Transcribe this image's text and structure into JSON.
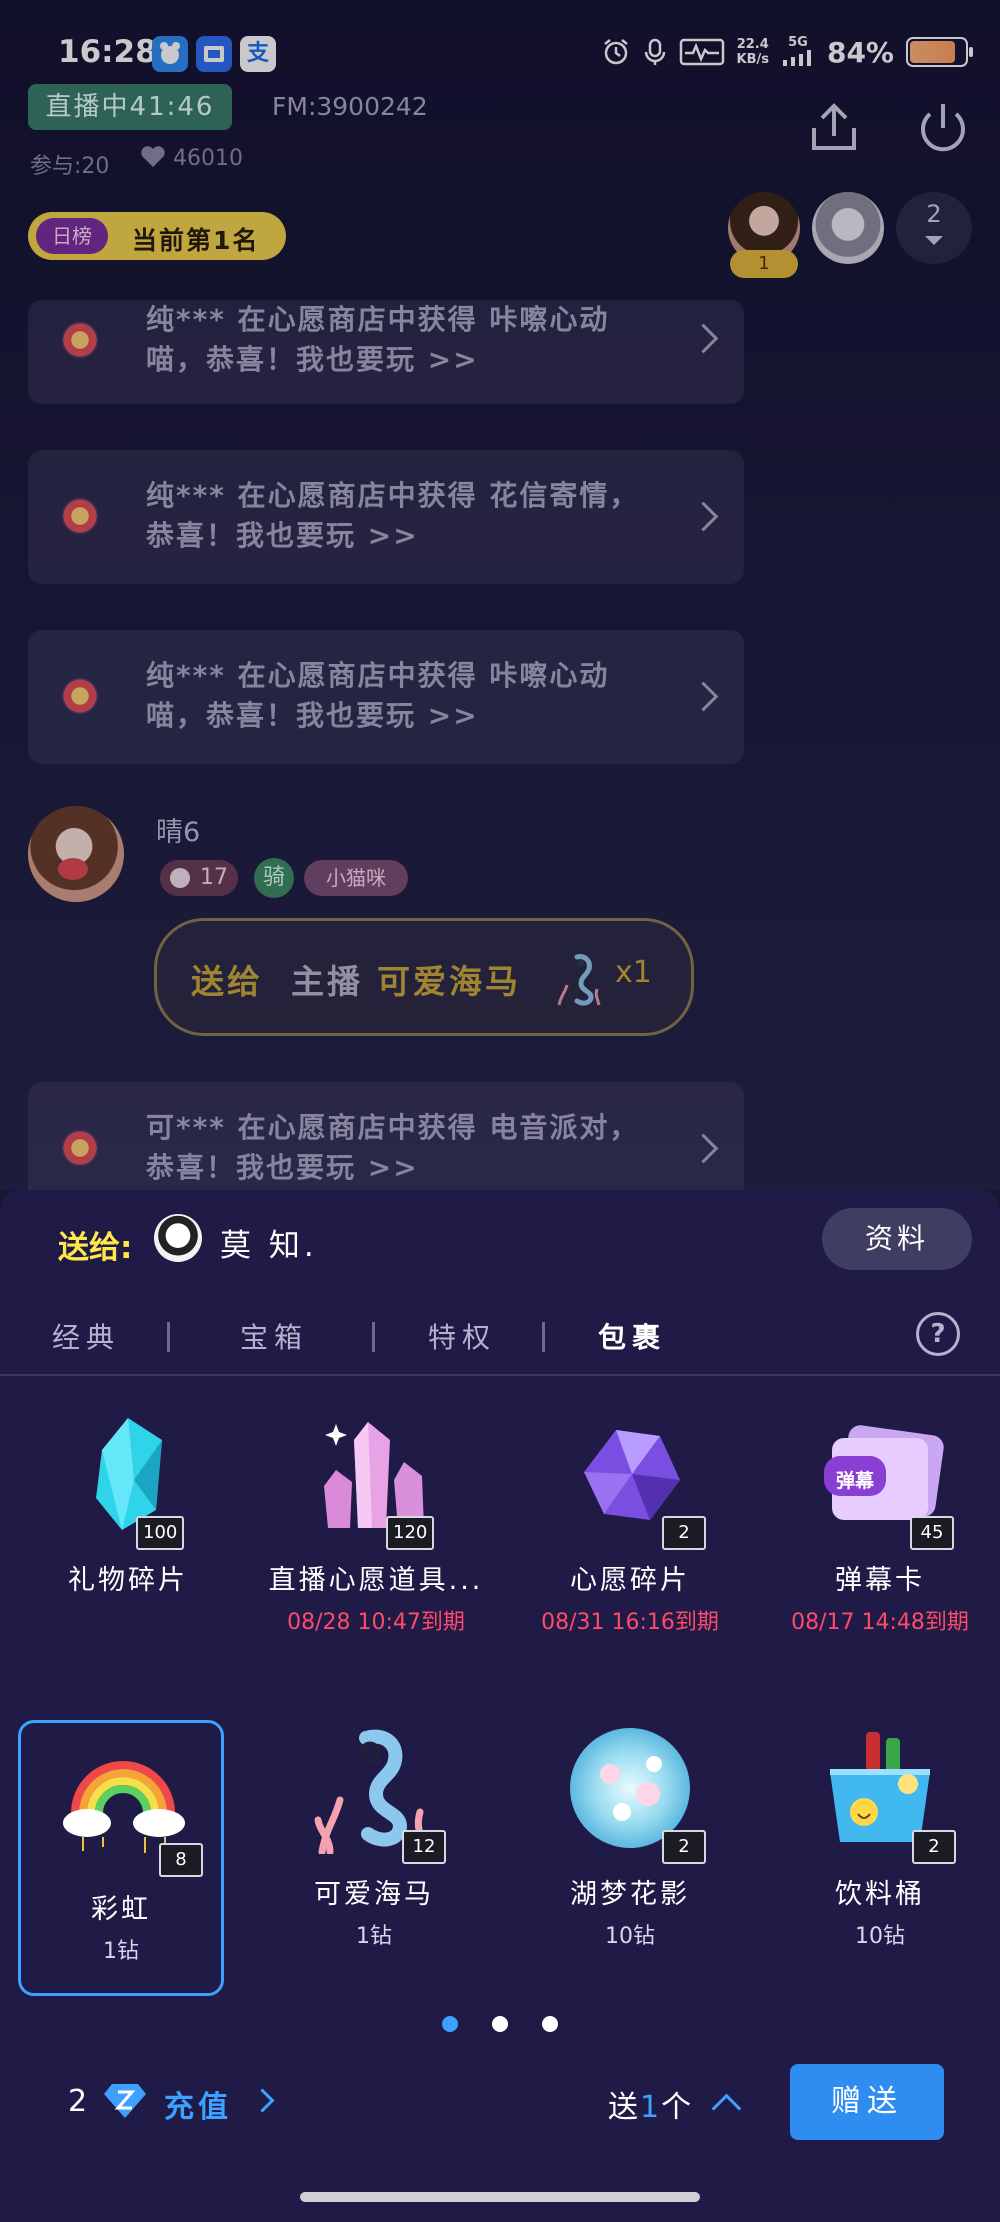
{
  "status_bar": {
    "time": "16:28",
    "apps": [
      "bird-app-icon",
      "chat-app-icon",
      "pay-app-icon"
    ],
    "pay_app_glyph": "支",
    "net_speed_value": "22.4",
    "net_speed_unit": "KB/s",
    "network": "5G",
    "battery_percent": "84%",
    "battery_level": 0.84
  },
  "header": {
    "live_label": "直播中41:46",
    "fm_id": "FM:3900242",
    "participants": "参与:20",
    "likes": "46010",
    "rank_tag": "日榜",
    "rank_text": "当前第1名",
    "viewer_rank": "1",
    "viewer_more_count": "2"
  },
  "chat": {
    "system_messages": [
      {
        "text": "纯*** 在心愿商店中获得 咔嚓心动喵，恭喜！我也要玩 >>"
      },
      {
        "text": "纯*** 在心愿商店中获得 花信寄情，恭喜！我也要玩 >>"
      },
      {
        "text": "纯*** 在心愿商店中获得 咔嚓心动喵，恭喜！我也要玩 >>"
      },
      {
        "text": "可*** 在心愿商店中获得 电音派对，恭喜！我也要玩 >>"
      }
    ],
    "user_message": {
      "name": "晴6",
      "level": "17",
      "ride_badge": "骑",
      "pet_badge": "小猫咪",
      "gift_send": "送给",
      "gift_target": "主播",
      "gift_name": "可爱海马",
      "gift_qty": "x1"
    }
  },
  "gift_panel": {
    "send_to_label": "送给:",
    "recipient_name": "莫 知.",
    "profile_button": "资料",
    "tabs": [
      "经典",
      "宝箱",
      "特权",
      "包裹"
    ],
    "active_tab": "包裹",
    "help_glyph": "?",
    "items": [
      {
        "name": "礼物碎片",
        "count": "100",
        "sub": ""
      },
      {
        "name": "直播心愿道具...",
        "count": "120",
        "sub": "08/28 10:47到期"
      },
      {
        "name": "心愿碎片",
        "count": "2",
        "sub": "08/31 16:16到期"
      },
      {
        "name": "弹幕卡",
        "count": "45",
        "sub": "08/17 14:48到期",
        "card_label": "弹幕"
      },
      {
        "name": "彩虹",
        "count": "8",
        "price": "1钻"
      },
      {
        "name": "可爱海马",
        "count": "12",
        "price": "1钻"
      },
      {
        "name": "湖梦花影",
        "count": "2",
        "price": "10钻"
      },
      {
        "name": "饮料桶",
        "count": "2",
        "price": "10钻"
      }
    ],
    "page_dots": 3,
    "active_page": 1,
    "balance": "2",
    "recharge_label": "充值",
    "send_prefix": "送",
    "send_qty": "1",
    "send_suffix": "个",
    "give_button": "赠送"
  },
  "colors": {
    "accent_blue": "#3ea0ff",
    "live_green": "#3a7b68",
    "rank_yellow": "#f3d34a",
    "expiry_red": "#ff4a6a",
    "panel_bg": "#1f1b46"
  }
}
